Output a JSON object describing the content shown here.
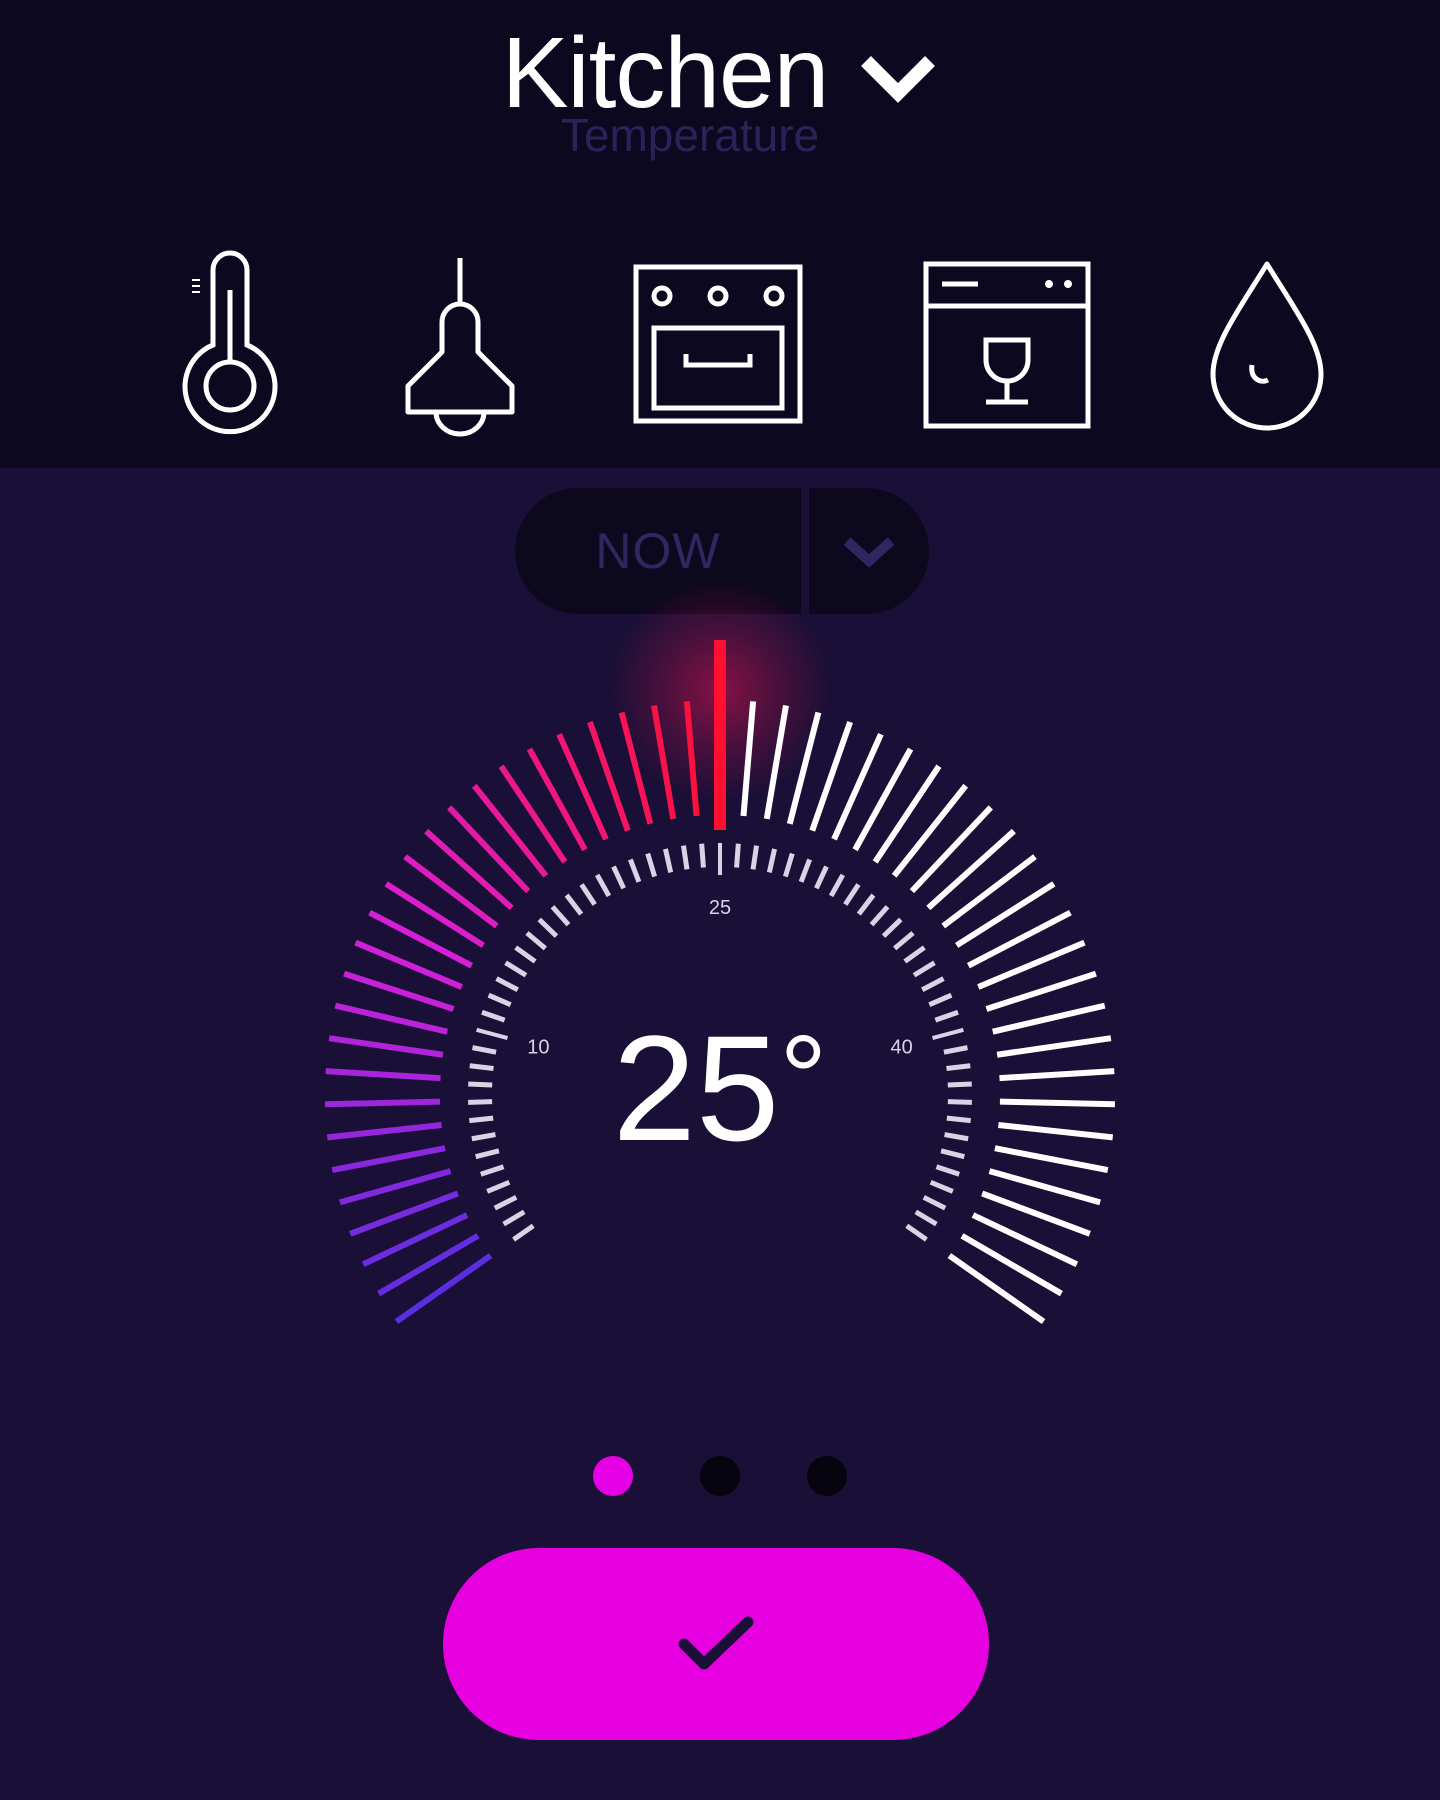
{
  "header": {
    "room_title": "Kitchen",
    "subtitle": "Temperature"
  },
  "devices": [
    {
      "name": "thermometer",
      "icon": "thermometer-icon",
      "active": true
    },
    {
      "name": "lamp",
      "icon": "lamp-icon",
      "active": false
    },
    {
      "name": "oven",
      "icon": "oven-icon",
      "active": false
    },
    {
      "name": "dishwasher",
      "icon": "dishwasher-icon",
      "active": false
    },
    {
      "name": "water",
      "icon": "water-drop-icon",
      "active": false
    }
  ],
  "mode": {
    "label": "NOW"
  },
  "dial": {
    "current_value": "25",
    "degree_symbol": "°",
    "min": 0,
    "max": 50,
    "value": 25,
    "scale_labels": [
      "10",
      "25",
      "40"
    ],
    "colors": {
      "low": "#5a2ee0",
      "mid": "#d81fd8",
      "high": "#ff1030",
      "inactive": "#ffffff"
    }
  },
  "pager": {
    "count": 3,
    "active_index": 0
  },
  "confirm": {
    "icon": "checkmark-icon"
  },
  "colors": {
    "accent": "#e600e0",
    "background": "#1a0f36",
    "header_background": "#0b0820"
  }
}
